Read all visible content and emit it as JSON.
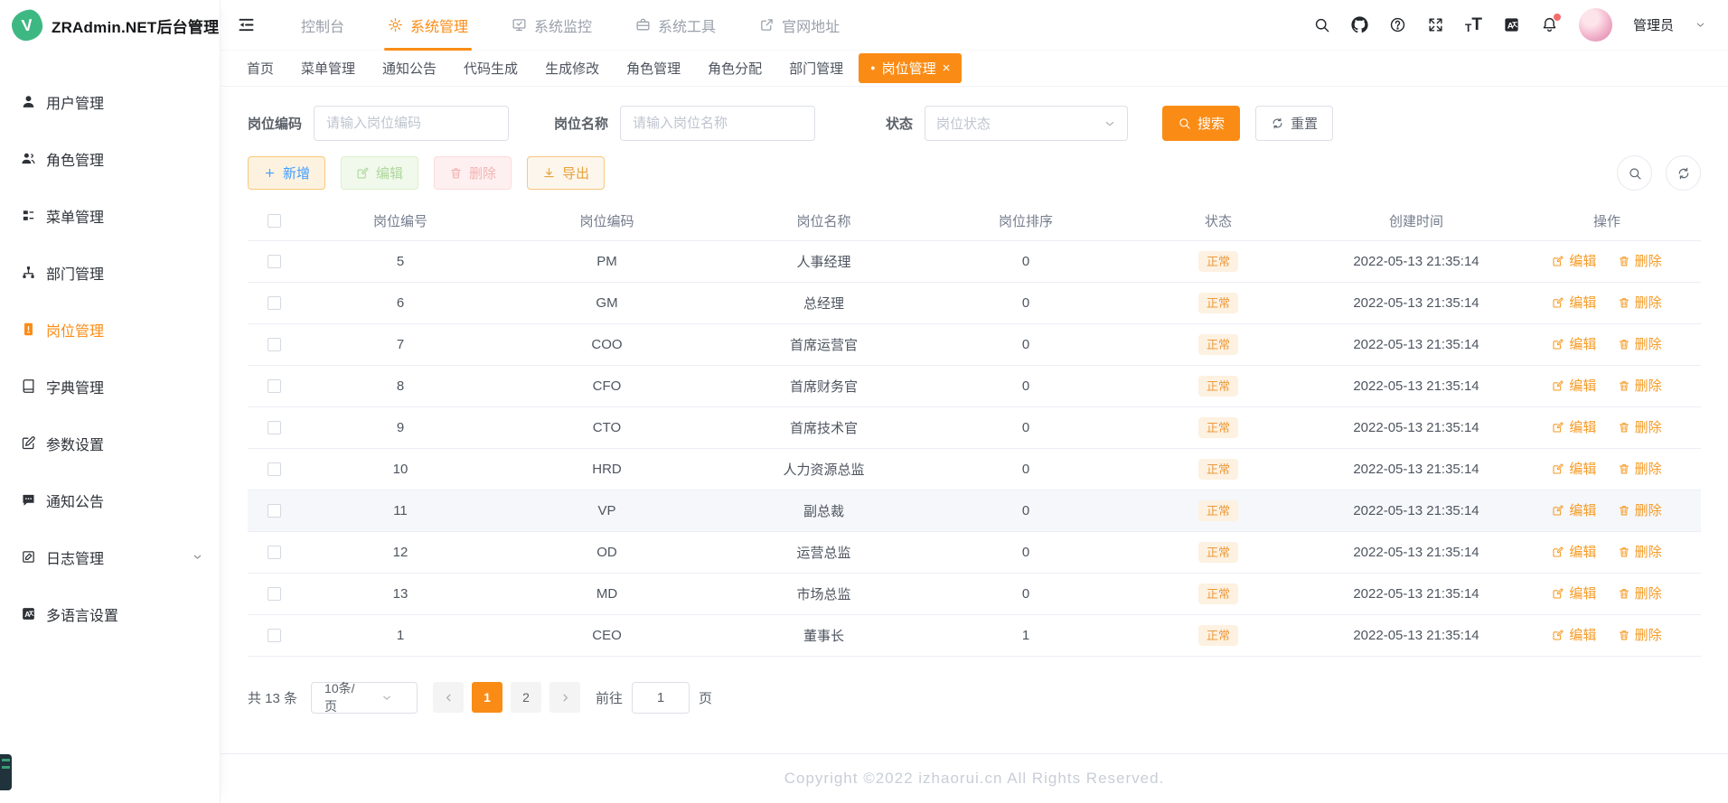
{
  "app": {
    "title": "ZRAdmin.NET后台管理",
    "logo_letter": "V"
  },
  "sidebar": {
    "items": [
      {
        "label": "用户管理",
        "icon": "user"
      },
      {
        "label": "角色管理",
        "icon": "users"
      },
      {
        "label": "菜单管理",
        "icon": "menu"
      },
      {
        "label": "部门管理",
        "icon": "org"
      },
      {
        "label": "岗位管理",
        "icon": "badge",
        "active": true
      },
      {
        "label": "字典管理",
        "icon": "book"
      },
      {
        "label": "参数设置",
        "icon": "edit-square"
      },
      {
        "label": "通知公告",
        "icon": "chat"
      },
      {
        "label": "日志管理",
        "icon": "log",
        "expandable": true
      },
      {
        "label": "多语言设置",
        "icon": "translate"
      }
    ]
  },
  "header": {
    "nav": [
      {
        "label": "控制台"
      },
      {
        "label": "系统管理",
        "icon": "gear",
        "active": true
      },
      {
        "label": "系统监控",
        "icon": "monitor"
      },
      {
        "label": "系统工具",
        "icon": "toolbox"
      },
      {
        "label": "官网地址",
        "icon": "external"
      }
    ],
    "icons": [
      "search",
      "github",
      "help",
      "fullscreen",
      "font-size",
      "language",
      "notification"
    ],
    "user_name": "管理员"
  },
  "tabs": [
    {
      "label": "首页"
    },
    {
      "label": "菜单管理"
    },
    {
      "label": "通知公告"
    },
    {
      "label": "代码生成"
    },
    {
      "label": "生成修改"
    },
    {
      "label": "角色管理"
    },
    {
      "label": "角色分配"
    },
    {
      "label": "部门管理"
    },
    {
      "label": "岗位管理",
      "active": true,
      "closable": true,
      "dot": "●",
      "close": "×"
    }
  ],
  "filters": {
    "code_label": "岗位编码",
    "code_placeholder": "请输入岗位编码",
    "name_label": "岗位名称",
    "name_placeholder": "请输入岗位名称",
    "status_label": "状态",
    "status_placeholder": "岗位状态",
    "search_label": "搜索",
    "reset_label": "重置"
  },
  "toolbar": {
    "add_label": "新增",
    "edit_label": "编辑",
    "delete_label": "删除",
    "export_label": "导出"
  },
  "table": {
    "headers": [
      "岗位编号",
      "岗位编码",
      "岗位名称",
      "岗位排序",
      "状态",
      "创建时间",
      "操作"
    ],
    "edit_label": "编辑",
    "delete_label": "删除",
    "rows": [
      {
        "id": "5",
        "code": "PM",
        "name": "人事经理",
        "sort": "0",
        "status": "正常",
        "created": "2022-05-13 21:35:14"
      },
      {
        "id": "6",
        "code": "GM",
        "name": "总经理",
        "sort": "0",
        "status": "正常",
        "created": "2022-05-13 21:35:14"
      },
      {
        "id": "7",
        "code": "COO",
        "name": "首席运营官",
        "sort": "0",
        "status": "正常",
        "created": "2022-05-13 21:35:14"
      },
      {
        "id": "8",
        "code": "CFO",
        "name": "首席财务官",
        "sort": "0",
        "status": "正常",
        "created": "2022-05-13 21:35:14"
      },
      {
        "id": "9",
        "code": "CTO",
        "name": "首席技术官",
        "sort": "0",
        "status": "正常",
        "created": "2022-05-13 21:35:14"
      },
      {
        "id": "10",
        "code": "HRD",
        "name": "人力资源总监",
        "sort": "0",
        "status": "正常",
        "created": "2022-05-13 21:35:14"
      },
      {
        "id": "11",
        "code": "VP",
        "name": "副总裁",
        "sort": "0",
        "status": "正常",
        "created": "2022-05-13 21:35:14",
        "highlight": true
      },
      {
        "id": "12",
        "code": "OD",
        "name": "运营总监",
        "sort": "0",
        "status": "正常",
        "created": "2022-05-13 21:35:14"
      },
      {
        "id": "13",
        "code": "MD",
        "name": "市场总监",
        "sort": "0",
        "status": "正常",
        "created": "2022-05-13 21:35:14"
      },
      {
        "id": "1",
        "code": "CEO",
        "name": "董事长",
        "sort": "1",
        "status": "正常",
        "created": "2022-05-13 21:35:14"
      }
    ]
  },
  "pagination": {
    "total_text": "共 13 条",
    "page_size": "10条/页",
    "pages": [
      {
        "num": "1",
        "current": true
      },
      {
        "num": "2"
      }
    ],
    "goto_label": "前往",
    "goto_value": "1",
    "goto_unit": "页"
  },
  "footer": {
    "copyright": "Copyright ©2022 izhaorui.cn All Rights Reserved."
  },
  "colors": {
    "accent_orange": "#fa8c16",
    "logo_green": "#3eb883",
    "badge_bg": "#fdf1e1",
    "badge_text": "#ed9a3c",
    "add_text_blue": "#409eff",
    "danger_red": "#f56c6c"
  }
}
